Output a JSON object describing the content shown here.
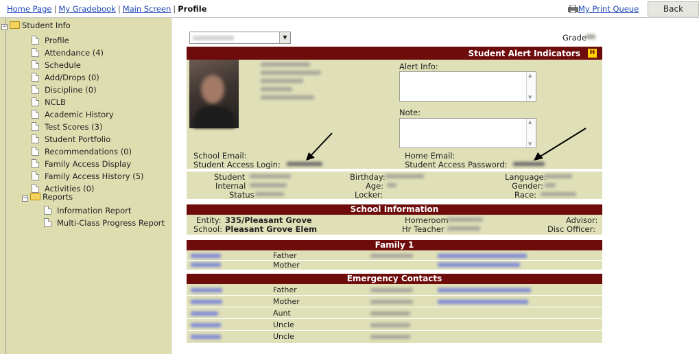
{
  "breadcrumb": {
    "home": "Home Page",
    "gradebook": "My Gradebook",
    "main_screen": "Main Screen",
    "current": "Profile",
    "separator": "|"
  },
  "toolbar": {
    "print_queue": "My Print Queue",
    "back": "Back"
  },
  "sidebar": {
    "root": "Student Info",
    "items": [
      "Profile",
      "Attendance (4)",
      "Schedule",
      "Add/Drops (0)",
      "Discipline (0)",
      "NCLB",
      "Academic History",
      "Test Scores (3)",
      "Student Portfolio",
      "Recommendations (0)",
      "Family Access Display",
      "Family Access History (5)",
      "Activities (0)"
    ],
    "reports_folder": "Reports",
    "reports": [
      "Information Report",
      "Multi-Class Progress Report"
    ]
  },
  "profile": {
    "grade_label": "Grade",
    "alert_header": "Student Alert Indicators",
    "alert_badge": "H",
    "alert_info_label": "Alert Info:",
    "note_label": "Note:",
    "school_email_label": "School Email:",
    "home_email_label": "Home Email:",
    "access_login_label": "Student Access Login:",
    "access_password_label": "Student Access Password:",
    "student_id_label": "Student",
    "internal_id_label": "Internal",
    "status_label": "Status",
    "birthday_label": "Birthday:",
    "age_label": "Age:",
    "locker_label": "Locker:",
    "language_label": "Language:",
    "gender_label": "Gender:",
    "race_label": "Race:"
  },
  "school_info": {
    "header": "School Information",
    "entity_label": "Entity:",
    "entity_value": "335/Pleasant Grove",
    "school_label": "School:",
    "school_value": "Pleasant Grove Elem",
    "homeroom_label": "Homeroom",
    "hr_teacher_label": "Hr Teacher",
    "advisor_label": "Advisor:",
    "disc_officer_label": "Disc Officer:"
  },
  "family": {
    "header": "Family 1",
    "relations": [
      "Father",
      "Mother"
    ]
  },
  "emergency": {
    "header": "Emergency Contacts",
    "relations": [
      "Father",
      "Mother",
      "Aunt",
      "Uncle",
      "Uncle"
    ]
  },
  "colors": {
    "header_maroon": "#6e0b0b",
    "panel_bg": "#e0e0b8",
    "sidebar_bg": "#ddddb0",
    "link_blue": "#1d44b8",
    "badge_yellow": "#ffd400"
  }
}
